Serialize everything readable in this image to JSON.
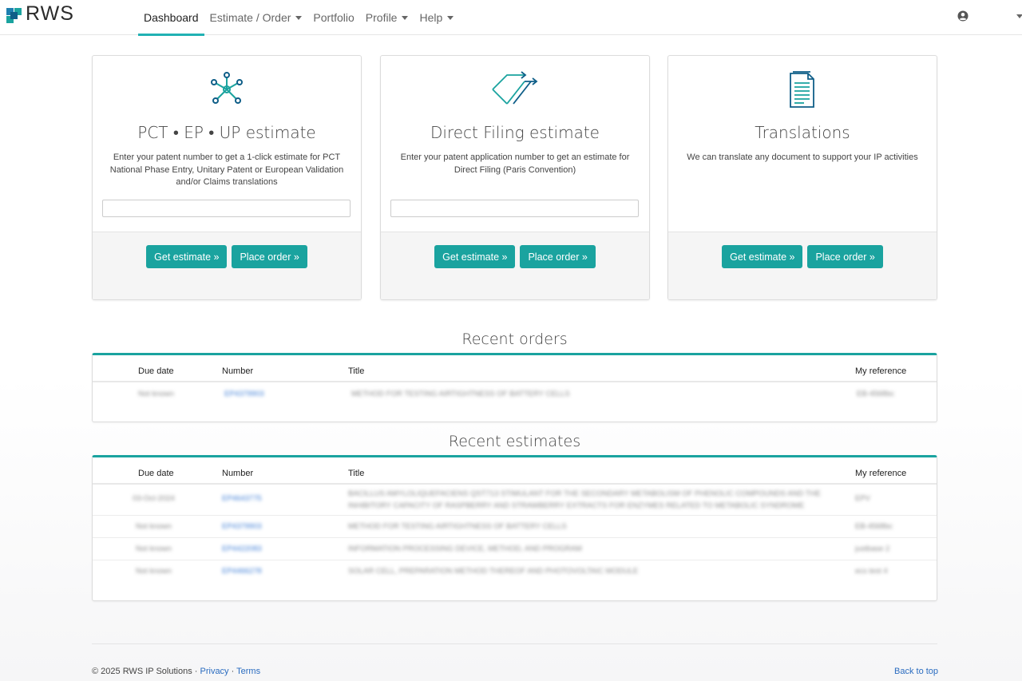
{
  "brand": {
    "name": "RWS",
    "colors": {
      "accent": "#1aa39f",
      "nav_active": "#21b1b3",
      "link": "#3a7bd5"
    }
  },
  "nav": {
    "items": [
      {
        "label": "Dashboard",
        "active": true,
        "dropdown": false
      },
      {
        "label": "Estimate / Order",
        "active": false,
        "dropdown": true
      },
      {
        "label": "Portfolio",
        "active": false,
        "dropdown": false
      },
      {
        "label": "Profile",
        "active": false,
        "dropdown": true
      },
      {
        "label": "Help",
        "active": false,
        "dropdown": true
      }
    ],
    "user_icon": "user-circle-icon"
  },
  "cards": [
    {
      "icon": "network-hub-icon",
      "title": "PCT • EP • UP estimate",
      "description": "Enter your patent number to get a 1-click estimate for PCT National Phase Entry, Unitary Patent or European Validation and/or Claims translations",
      "input_value": "",
      "buttons": [
        "Get estimate »",
        "Place order »"
      ]
    },
    {
      "icon": "direct-filing-arrows-icon",
      "title": "Direct Filing estimate",
      "description": "Enter your patent application number to get an estimate for Direct Filing (Paris Convention)",
      "input_value": "",
      "buttons": [
        "Get estimate »",
        "Place order »"
      ]
    },
    {
      "icon": "document-icon",
      "title": "Translations",
      "description": "We can translate any document to support your IP activities",
      "buttons": [
        "Get estimate »",
        "Place order »"
      ]
    }
  ],
  "recent_orders": {
    "title": "Recent orders",
    "columns": [
      "Due date",
      "Number",
      "Title",
      "My reference"
    ],
    "rows": [
      {
        "due": "Not known",
        "number": "EP4379903",
        "title": "METHOD FOR TESTING AIRTIGHTNESS OF BATTERY CELLS",
        "ref": "EB-4568bc"
      }
    ]
  },
  "recent_estimates": {
    "title": "Recent estimates",
    "columns": [
      "Due date",
      "Number",
      "Title",
      "My reference"
    ],
    "rows": [
      {
        "due": "03-Oct-2024",
        "number": "EP4643775",
        "title": "BACILLUS AMYLOLIQUEFACIENS QST713 STIMULANT FOR THE SECONDARY METABOLISM OF PHENOLIC COMPOUNDS AND THE INHIBITORY CAPACITY OF RASPBERRY AND STRAWBERRY EXTRACTS FOR ENZYMES RELATED TO METABOLIC SYNDROME",
        "ref": "EPV"
      },
      {
        "due": "Not known",
        "number": "EP4379903",
        "title": "METHOD FOR TESTING AIRTIGHTNESS OF BATTERY CELLS",
        "ref": "EB-4568bc"
      },
      {
        "due": "Not known",
        "number": "EP4422083",
        "title": "INFORMATION PROCESSING DEVICE, METHOD, AND PROGRAM",
        "ref": "justbase 2"
      },
      {
        "due": "Not known",
        "number": "EP4466278",
        "title": "SOLAR CELL, PREPARATION METHOD THEREOF AND PHOTOVOLTAIC MODULE",
        "ref": "ecs test 4"
      }
    ]
  },
  "footer": {
    "copyright": "© 2025 RWS IP Solutions · ",
    "privacy": "Privacy",
    "sep": " · ",
    "terms": "Terms",
    "back_to_top": "Back to top"
  }
}
